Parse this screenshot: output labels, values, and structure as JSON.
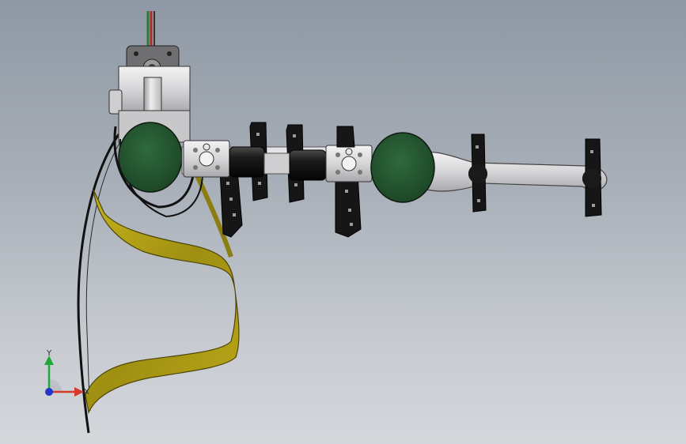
{
  "viewport": {
    "background_top": "#8f98a4",
    "background_bottom": "#d4d7db"
  },
  "model": {
    "components": [
      "power-cable",
      "shoulder-bracket",
      "joint-disc-1",
      "gearbox-1",
      "motor-1",
      "motor-2",
      "gearbox-2",
      "joint-disc-2",
      "forearm-link",
      "gripper-clip-1",
      "gripper-clip-2",
      "gripper-clip-3",
      "gripper-clip-4",
      "gripper-clip-5",
      "gripper-clip-6",
      "gripper-clip-7",
      "flexible-ribbon",
      "black-wire"
    ],
    "colors": {
      "joint_disc": "#245430",
      "ribbon": "#b4a316",
      "metal": "#d9d9db",
      "motor": "#1a1a1a"
    }
  },
  "triad": {
    "y_label": "Y",
    "x_label": "X",
    "y_color": "#22a83a",
    "x_color": "#d43a2a",
    "z_color": "#2433c8"
  }
}
